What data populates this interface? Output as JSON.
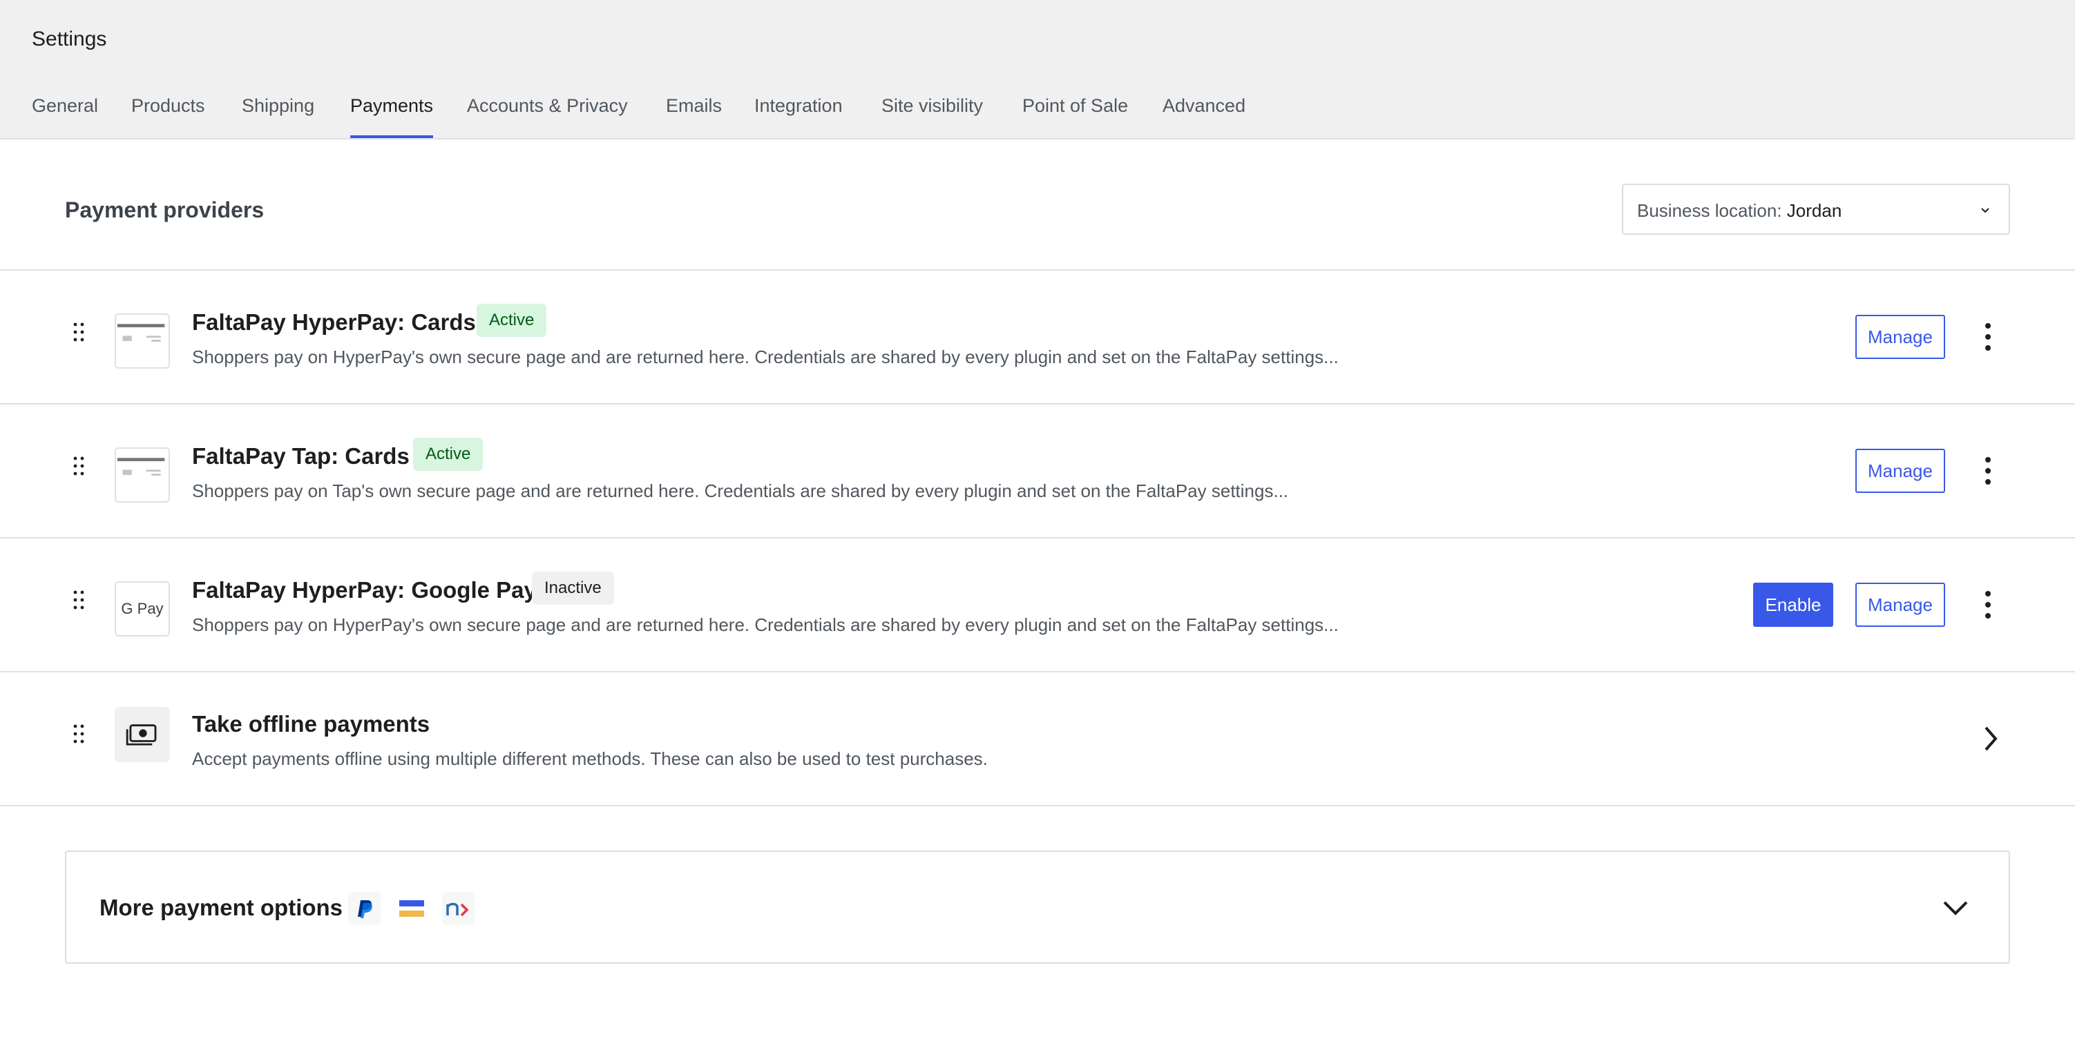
{
  "header": {
    "title": "Settings",
    "tabs": [
      {
        "label": "General",
        "active": false
      },
      {
        "label": "Products",
        "active": false
      },
      {
        "label": "Shipping",
        "active": false
      },
      {
        "label": "Payments",
        "active": true
      },
      {
        "label": "Accounts & Privacy",
        "active": false
      },
      {
        "label": "Emails",
        "active": false
      },
      {
        "label": "Integration",
        "active": false
      },
      {
        "label": "Site visibility",
        "active": false
      },
      {
        "label": "Point of Sale",
        "active": false
      },
      {
        "label": "Advanced",
        "active": false
      }
    ]
  },
  "providers": {
    "title": "Payment providers",
    "location_label": "Business location:",
    "location_value": "Jordan",
    "items": [
      {
        "name": "FaltaPay HyperPay: Cards",
        "status": "Active",
        "description": "Shoppers pay on HyperPay's own secure page and are returned here. Credentials are shared by every plugin and set on the FaltaPay settings...",
        "logo": "card-icon",
        "manage_label": "Manage"
      },
      {
        "name": "FaltaPay Tap: Cards",
        "status": "Active",
        "description": "Shoppers pay on Tap's own secure page and are returned here. Credentials are shared by every plugin and set on the FaltaPay settings...",
        "logo": "card-icon",
        "manage_label": "Manage"
      },
      {
        "name": "FaltaPay HyperPay: Google Pay",
        "status": "Inactive",
        "description": "Shoppers pay on HyperPay's own secure page and are returned here. Credentials are shared by every plugin and set on the FaltaPay settings...",
        "logo": "google-pay-icon",
        "logo_text": "G Pay",
        "enable_label": "Enable",
        "manage_label": "Manage"
      },
      {
        "name": "Take offline payments",
        "description": "Accept payments offline using multiple different methods. These can also be used to test purchases.",
        "logo": "cash-icon"
      }
    ]
  },
  "more_options": {
    "title": "More payment options",
    "logos": [
      "paypal-icon",
      "stripe-flag-icon",
      "nexi-icon"
    ]
  },
  "colors": {
    "accent": "#3858e9",
    "active_bg": "#d7f5df",
    "active_text": "#005c12",
    "inactive_bg": "#f0f0f0"
  }
}
